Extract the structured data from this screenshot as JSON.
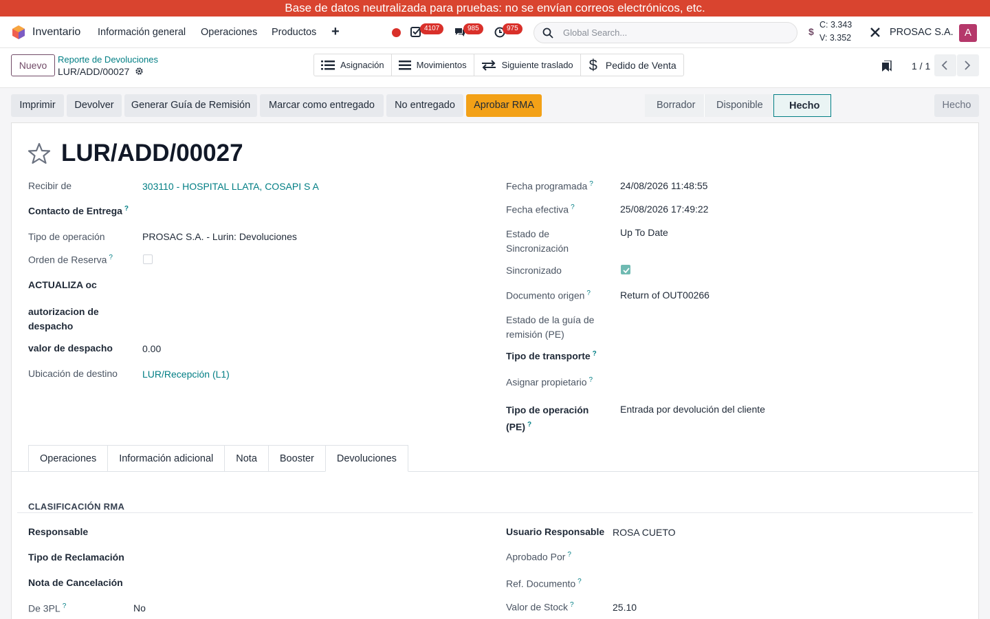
{
  "banner": {
    "text": "Base de datos neutralizada para pruebas: no se envían correos electrónicos, etc."
  },
  "navbar": {
    "app_name": "Inventario",
    "menu": [
      "Información general",
      "Operaciones",
      "Productos"
    ],
    "badges": {
      "activities": "4107",
      "messages": "985",
      "timers": "975"
    },
    "search_placeholder": "Global Search...",
    "rate_c": "C: 3.343",
    "rate_v": "V: 3.352",
    "company": "PROSAC S.A.",
    "avatar_letter": "A"
  },
  "control_panel": {
    "new_label": "Nuevo",
    "breadcrumb_parent": "Reporte de Devoluciones",
    "breadcrumb_current": "LUR/ADD/00027",
    "smart_buttons": [
      "Asignación",
      "Movimientos",
      "Siguiente traslado",
      "Pedido de Venta"
    ],
    "pager": "1 / 1"
  },
  "actions": {
    "buttons": [
      "Imprimir",
      "Devolver",
      "Generar Guía de Remisión",
      "Marcar como entregado",
      "No entregado"
    ],
    "primary": "Aprobar RMA",
    "statusbar": [
      "Borrador",
      "Disponible",
      "Hecho"
    ],
    "active_status": "Hecho",
    "right_tag": "Hecho"
  },
  "record": {
    "title": "LUR/ADD/00027",
    "left_fields": [
      {
        "label": "Recibir de",
        "value": "303110 - HOSPITAL LLATA, COSAPI S A"
      },
      {
        "label": "Contacto de Entrega",
        "value": ""
      },
      {
        "label": "Tipo de operación",
        "value": "PROSAC S.A. - Lurin: Devoluciones"
      },
      {
        "label": "Orden de Reserva",
        "value": ""
      },
      {
        "label": "ACTUALIZA oc",
        "value": ""
      },
      {
        "label": "autorizacion de despacho",
        "value": ""
      },
      {
        "label": "valor de despacho",
        "value": "0.00"
      },
      {
        "label": "Ubicación de destino",
        "value": "LUR/Recepción (L1)"
      }
    ],
    "right_fields": [
      {
        "label": "Fecha programada",
        "value": "24/08/2026 11:48:55"
      },
      {
        "label": "Fecha efectiva",
        "value": "25/08/2026 17:49:22"
      },
      {
        "label": "Estado de Sincronización",
        "value": "Up To Date"
      },
      {
        "label": "Sincronizado",
        "value": ""
      },
      {
        "label": "Documento origen",
        "value": "Return of OUT00266"
      },
      {
        "label": "Estado de la guía de remisión (PE)",
        "value": ""
      },
      {
        "label": "Tipo de transporte",
        "value": ""
      },
      {
        "label": "Asignar propietario",
        "value": ""
      },
      {
        "label": "Tipo de operación (PE)",
        "value": "Entrada por devolución del cliente"
      }
    ],
    "help_mark": "?"
  },
  "tabs": [
    "Operaciones",
    "Información adicional",
    "Nota",
    "Booster",
    "Devoluciones"
  ],
  "active_tab": "Devoluciones",
  "rma": {
    "section_title": "CLASIFICACIÓN RMA",
    "left_fields": [
      {
        "label": "Responsable",
        "value": ""
      },
      {
        "label": "Tipo de Reclamación",
        "value": ""
      },
      {
        "label": "Nota de Cancelación",
        "value": ""
      },
      {
        "label": "De 3PL",
        "value": "No"
      }
    ],
    "right_fields": [
      {
        "label": "Usuario Responsable",
        "value": "ROSA CUETO"
      },
      {
        "label": "Aprobado Por",
        "value": ""
      },
      {
        "label": "Ref. Documento",
        "value": ""
      },
      {
        "label": "Valor de Stock",
        "value": "25.10"
      }
    ]
  },
  "colors": {
    "banner": "#d9442f",
    "brand": "#714b67",
    "link": "#017e84",
    "primary_button": "#f3a117",
    "badge": "#d9302a"
  }
}
